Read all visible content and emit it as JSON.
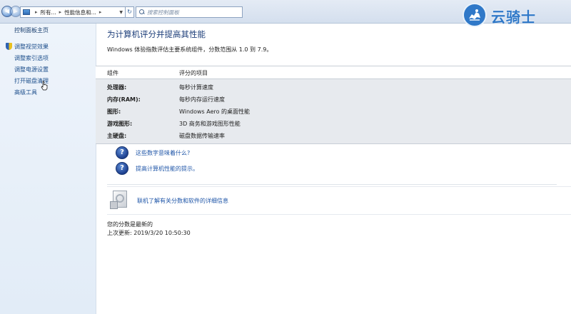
{
  "address_bar": {
    "crumbs": [
      "所有...",
      "性能信息和..."
    ],
    "search_placeholder": "搜索控制面板"
  },
  "watermark": {
    "text": "云骑士"
  },
  "sidebar": {
    "home": "控制面板主页",
    "items": [
      {
        "label": "调整视觉效果",
        "icon": "shield-icon"
      },
      {
        "label": "调整索引选项"
      },
      {
        "label": "调整电源设置"
      },
      {
        "label": "打开磁盘清理"
      },
      {
        "label": "高级工具"
      }
    ]
  },
  "main": {
    "title": "为计算机评分并提高其性能",
    "subtitle": "Windows 体验指数评估主要系统组件，分数范围从 1.0 到 7.9。",
    "table": {
      "headers": [
        "组件",
        "评分的项目"
      ],
      "rows": [
        {
          "component": "处理器:",
          "item": "每秒计算速度"
        },
        {
          "component": "内存(RAM):",
          "item": "每秒内存运行速度"
        },
        {
          "component": "图形:",
          "item": "Windows Aero 的桌面性能"
        },
        {
          "component": "游戏图形:",
          "item": "3D 商务和游戏图形性能"
        },
        {
          "component": "主硬盘:",
          "item": "磁盘数据传输速率"
        }
      ]
    },
    "help_links": [
      "这些数字意味着什么?",
      "提高计算机性能的提示。"
    ],
    "info_link": "联机了解有关分数和软件的详细信息",
    "status_line": "您的分数是最新的",
    "last_update": "上次更新: 2019/3/20 10:50:30"
  },
  "colors": {
    "title_blue": "#1e3f7a",
    "link_blue": "#1f56a8",
    "sidebar_bg": "#eef4fb",
    "table_body_bg": "#e7eaee",
    "watermark_blue": "#2f78c8"
  }
}
